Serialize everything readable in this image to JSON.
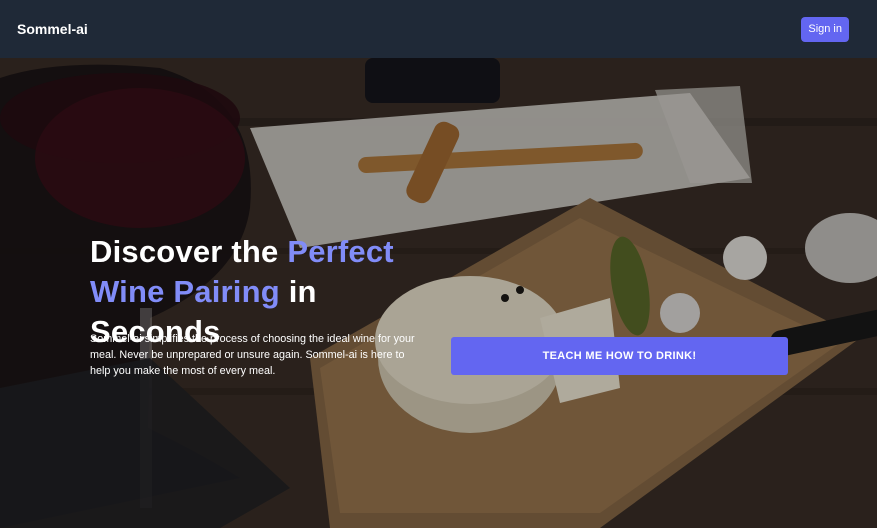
{
  "navbar": {
    "brand": "Sommel-ai",
    "signin_label": "Sign in"
  },
  "hero": {
    "title_line1": "Discover the",
    "title_accent": "Perfect Wine Pairing",
    "title_end": "in Seconds",
    "description": "Sommel-ai simplifies the process of choosing the ideal wine for your meal. Never be unprepared or unsure again. Sommel-ai is here to help you make the most of every meal.",
    "cta_label": "TEACH ME HOW TO DRINK!"
  },
  "colors": {
    "navbar_bg": "#1f2937",
    "accent": "#6366f1",
    "accent_text": "#818cf8",
    "text": "#ffffff"
  }
}
